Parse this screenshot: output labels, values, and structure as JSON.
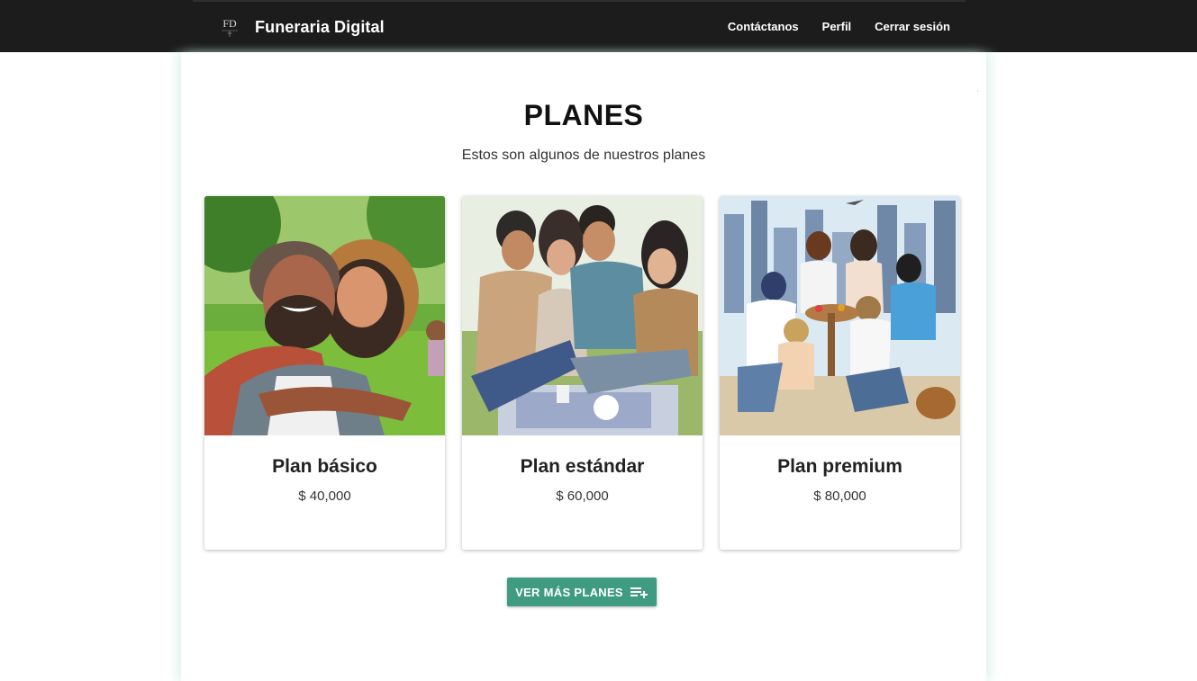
{
  "navbar": {
    "logo_text": "FD",
    "brand": "Funeraria Digital",
    "links": [
      {
        "label": "Contáctanos",
        "icon": "none"
      },
      {
        "label": "Perfil",
        "icon": "none"
      },
      {
        "label": "Cerrar sesión",
        "icon": "none"
      }
    ]
  },
  "main": {
    "title": "PLANES",
    "subtitle": "Estos son algunos de nuestros planes",
    "plans": [
      {
        "name": "Plan básico",
        "price": "$ 40,000",
        "image": "couple-hugging-in-park-illustration"
      },
      {
        "name": "Plan estándar",
        "price": "$ 60,000",
        "image": "friends-picnic-illustration"
      },
      {
        "name": "Plan premium",
        "price": "$ 80,000",
        "image": "friends-rooftop-city-party-illustration"
      }
    ],
    "more_button": {
      "label": "VER MÁS PLANES",
      "icon": "playlist-add-icon"
    }
  },
  "colors": {
    "navbar_bg": "#1c1c1c",
    "button_bg": "#3f9c80",
    "text_dark": "#111111"
  }
}
